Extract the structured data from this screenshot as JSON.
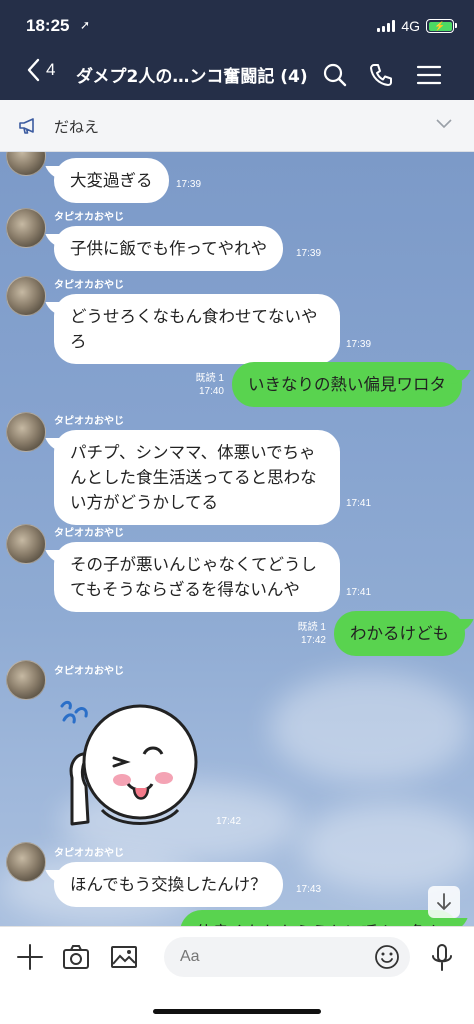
{
  "status": {
    "time": "18:25",
    "network": "4G"
  },
  "header": {
    "back_count": "4",
    "title": "ダメプ2人の…ンコ奮闘記 (4)"
  },
  "announcement": {
    "text": "だねえ"
  },
  "messages": [
    {
      "sender": "",
      "text": "大変過ぎる",
      "time": "17:39"
    },
    {
      "sender": "タピオカおやじ",
      "text": "子供に飯でも作ってやれや",
      "time": "17:39"
    },
    {
      "sender": "タピオカおやじ",
      "text": "どうせろくなもん食わせてないや\nろ",
      "time": "17:39"
    },
    {
      "read": "既読 1",
      "text": "いきなりの熱い偏見ワロタ",
      "time": "17:40"
    },
    {
      "sender": "タピオカおやじ",
      "text": "パチプ、シンママ、体悪いでちゃ\nんとした食生活送ってると思わな\nい方がどうかしてる",
      "time": "17:41"
    },
    {
      "sender": "タピオカおやじ",
      "text": "その子が悪いんじゃなくてどうし\nてもそうならざるを得ないんや",
      "time": "17:41"
    },
    {
      "read": "既読 1",
      "text": "わかるけども",
      "time": "17:42"
    },
    {
      "sender": "タピオカおやじ",
      "sticker": "wink-face-sticker",
      "time": "17:42"
    },
    {
      "sender": "タピオカおやじ",
      "text": "ほんでもう交換したんけ？",
      "time": "17:43"
    },
    {
      "text": "仲良くなれたらうちに呼んで色々"
    }
  ],
  "input": {
    "placeholder": "Aa"
  },
  "colors": {
    "header_bg": "#252f48",
    "my_bubble": "#59d34f",
    "chat_bg": "#86a3cf"
  }
}
